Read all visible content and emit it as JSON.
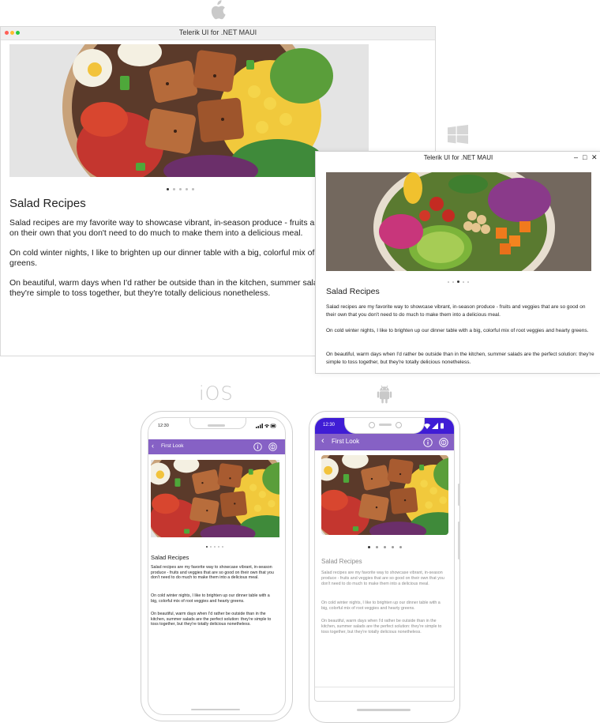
{
  "platforms": {
    "ios_label": "iOS"
  },
  "app": {
    "window_title": "Telerik UI for .NET MAUI",
    "nav_title": "First Look"
  },
  "content": {
    "heading": "Salad Recipes",
    "paragraphs": [
      "Salad recipes are my favorite way to showcase vibrant, in-season produce - fruits and veggies that are so good on their own that you don't need to do much to make them into a delicious meal.",
      "On cold winter nights, I like to brighten up our dinner table with a big, colorful mix of root veggies and hearty greens.",
      "On beautiful, warm days when I'd rather be outside than in the kitchen, summer salads are the perfect solution: they're simple to toss together, but they're totally delicious nonetheless."
    ]
  },
  "ios_status": {
    "time": "12:30"
  },
  "android_status": {
    "time": "12:30"
  },
  "carousel": {
    "count": 5,
    "mac_index": 0,
    "windows_index": 2,
    "ios_index": 0,
    "android_index": 0
  },
  "icons": [
    "apple-logo",
    "windows-logo",
    "android-logo",
    "back-chevron",
    "info-icon",
    "theme-icon",
    "minimize-icon",
    "maximize-icon",
    "close-icon"
  ],
  "colors": {
    "nav_bar": "#8661c5",
    "android_status_bar": "#3f1dd5",
    "mac_close": "#ff5f57",
    "mac_min": "#febc2e",
    "mac_max": "#28c840"
  }
}
